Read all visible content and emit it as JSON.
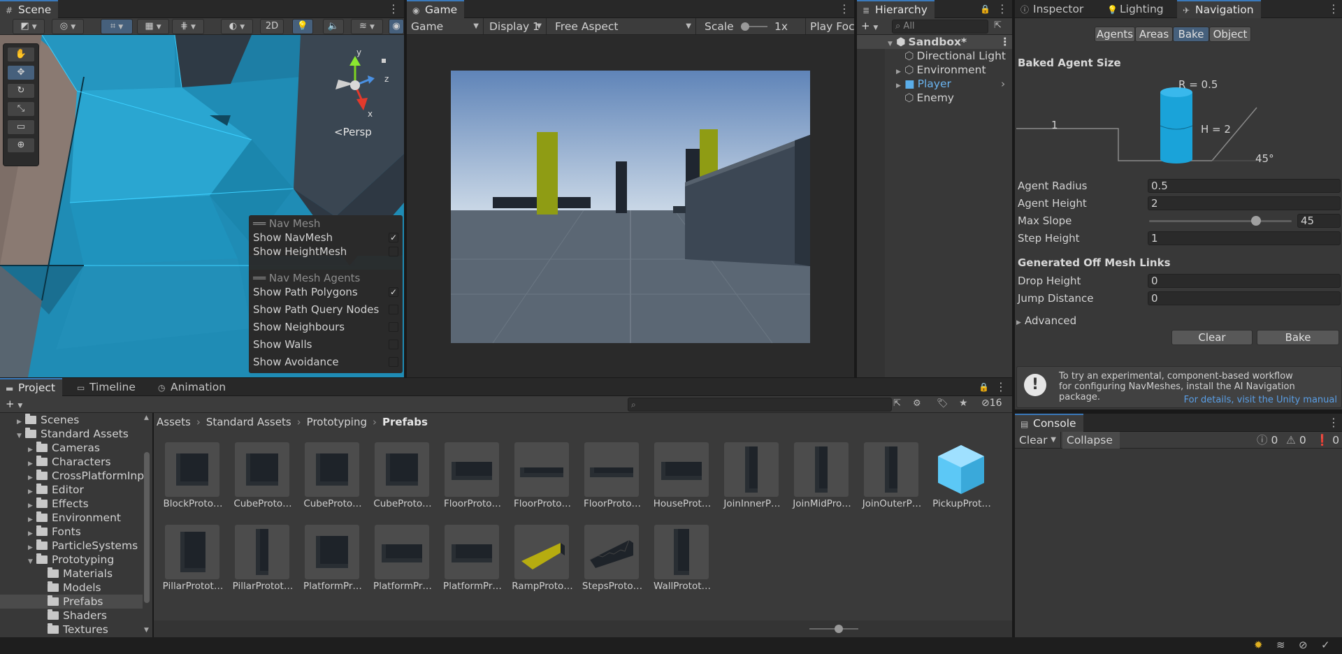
{
  "scene": {
    "tab": "Scene",
    "btn_2d": "2D",
    "gizmo_persp": "Persp",
    "gizmo_y": "y",
    "gizmo_z": "z",
    "gizmo_x": "x",
    "navmesh_overlay": {
      "title": "Nav Mesh",
      "items": [
        {
          "label": "Show NavMesh",
          "checked": true
        },
        {
          "label": "Show HeightMesh",
          "checked": false
        }
      ]
    },
    "agents_overlay": {
      "title": "Nav Mesh Agents",
      "items": [
        {
          "label": "Show Path Polygons",
          "checked": true
        },
        {
          "label": "Show Path Query Nodes",
          "checked": false
        },
        {
          "label": "Show Neighbours",
          "checked": false
        },
        {
          "label": "Show Walls",
          "checked": false
        },
        {
          "label": "Show Avoidance",
          "checked": false
        }
      ]
    }
  },
  "game": {
    "tab": "Game",
    "mode": "Game",
    "display": "Display 1",
    "aspect": "Free Aspect",
    "scale_label": "Scale",
    "scale_value": "1x",
    "play_focused": "Play Foc"
  },
  "hierarchy": {
    "tab": "Hierarchy",
    "search_placeholder": "All",
    "scene_name": "Sandbox*",
    "items": [
      "Directional Light",
      "Environment",
      "Player",
      "Enemy"
    ]
  },
  "inspector": {
    "tabs": [
      "Inspector",
      "Lighting",
      "Navigation"
    ],
    "nav_tabs": [
      "Agents",
      "Areas",
      "Bake",
      "Object"
    ],
    "baked_agent_size": "Baked Agent Size",
    "diagram": {
      "r": "R = 0.5",
      "h": "H = 2",
      "step": "1",
      "slope": "45°"
    },
    "fields": [
      {
        "label": "Agent Radius",
        "value": "0.5"
      },
      {
        "label": "Agent Height",
        "value": "2"
      },
      {
        "label": "Max Slope",
        "value": "45"
      },
      {
        "label": "Step Height",
        "value": "1"
      }
    ],
    "max_slope_fraction": 0.75,
    "offmesh_header": "Generated Off Mesh Links",
    "offmesh_fields": [
      {
        "label": "Drop Height",
        "value": "0"
      },
      {
        "label": "Jump Distance",
        "value": "0"
      }
    ],
    "advanced": "Advanced",
    "clear": "Clear",
    "bake": "Bake",
    "info_text": "To try an experimental, component-based workflow for configuring NavMeshes, install the AI Navigation package.",
    "info_link": "For details, visit the Unity manual"
  },
  "project": {
    "tabs": [
      "Project",
      "Timeline",
      "Animation"
    ],
    "hidden_count": "16",
    "breadcrumb": [
      "Assets",
      "Standard Assets",
      "Prototyping",
      "Prefabs"
    ],
    "tree": [
      {
        "label": "Scenes",
        "indent": 1,
        "arrow": "right"
      },
      {
        "label": "Standard Assets",
        "indent": 1,
        "arrow": "down"
      },
      {
        "label": "Cameras",
        "indent": 2,
        "arrow": "right"
      },
      {
        "label": "Characters",
        "indent": 2,
        "arrow": "right"
      },
      {
        "label": "CrossPlatformInp",
        "indent": 2,
        "arrow": "right"
      },
      {
        "label": "Editor",
        "indent": 2,
        "arrow": "right"
      },
      {
        "label": "Effects",
        "indent": 2,
        "arrow": "right"
      },
      {
        "label": "Environment",
        "indent": 2,
        "arrow": "right"
      },
      {
        "label": "Fonts",
        "indent": 2,
        "arrow": "right"
      },
      {
        "label": "ParticleSystems",
        "indent": 2,
        "arrow": "right"
      },
      {
        "label": "Prototyping",
        "indent": 2,
        "arrow": "down"
      },
      {
        "label": "Materials",
        "indent": 3,
        "arrow": ""
      },
      {
        "label": "Models",
        "indent": 3,
        "arrow": ""
      },
      {
        "label": "Prefabs",
        "indent": 3,
        "arrow": "",
        "selected": true
      },
      {
        "label": "Shaders",
        "indent": 3,
        "arrow": ""
      },
      {
        "label": "Textures",
        "indent": 3,
        "arrow": ""
      }
    ],
    "assets": [
      {
        "label": "BlockProto…",
        "shape": "cube"
      },
      {
        "label": "CubeProto…",
        "shape": "cube"
      },
      {
        "label": "CubeProto…",
        "shape": "cube"
      },
      {
        "label": "CubeProto…",
        "shape": "cube"
      },
      {
        "label": "FloorProto…",
        "shape": "slab"
      },
      {
        "label": "FloorProto…",
        "shape": "flat"
      },
      {
        "label": "FloorProto…",
        "shape": "flat"
      },
      {
        "label": "HouseProt…",
        "shape": "slab"
      },
      {
        "label": "JoinInnerP…",
        "shape": "pillar"
      },
      {
        "label": "JoinMidPro…",
        "shape": "pillar"
      },
      {
        "label": "JoinOuterP…",
        "shape": "pillar"
      },
      {
        "label": "PickupProt…",
        "shape": "pickup"
      },
      {
        "label": "PillarProtot…",
        "shape": "block"
      },
      {
        "label": "PillarProtot…",
        "shape": "pillar"
      },
      {
        "label": "PlatformPr…",
        "shape": "cube"
      },
      {
        "label": "PlatformPr…",
        "shape": "slab"
      },
      {
        "label": "PlatformPr…",
        "shape": "slab"
      },
      {
        "label": "RampProto…",
        "shape": "ramp"
      },
      {
        "label": "StepsProto…",
        "shape": "steps"
      },
      {
        "label": "WallProtot…",
        "shape": "wall"
      }
    ]
  },
  "console": {
    "tab": "Console",
    "clear": "Clear",
    "collapse": "Collapse",
    "counts": [
      "0",
      "0",
      "0"
    ]
  },
  "colors": {
    "accent": "#3a79bb",
    "navmesh": "#2bb5e8",
    "yellow": "#a8a600"
  }
}
